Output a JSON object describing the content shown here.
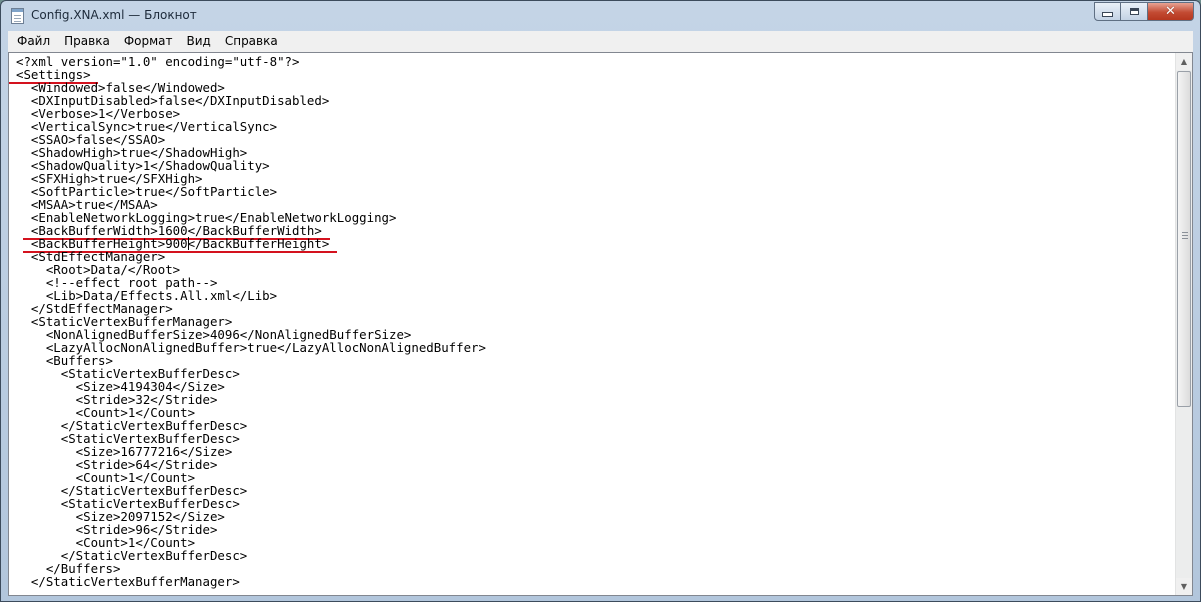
{
  "window": {
    "title": "Config.XNA.xml — Блокнот",
    "icon": "notepad-icon",
    "controls": [
      "minimize-icon",
      "maximize-icon",
      "close-icon"
    ]
  },
  "menu": [
    "Файл",
    "Правка",
    "Формат",
    "Вид",
    "Справка"
  ],
  "editor": {
    "lines": [
      "<?xml version=\"1.0\" encoding=\"utf-8\"?>",
      "<Settings>",
      "  <Windowed>false</Windowed>",
      "  <DXInputDisabled>false</DXInputDisabled>",
      "  <Verbose>1</Verbose>",
      "  <VerticalSync>true</VerticalSync>",
      "  <SSAO>false</SSAO>",
      "  <ShadowHigh>true</ShadowHigh>",
      "  <ShadowQuality>1</ShadowQuality>",
      "  <SFXHigh>true</SFXHigh>",
      "  <SoftParticle>true</SoftParticle>",
      "  <MSAA>true</MSAA>",
      "  <EnableNetworkLogging>true</EnableNetworkLogging>",
      "  <BackBufferWidth>1600</BackBufferWidth>",
      "  <BackBufferHeight>900</BackBufferHeight>",
      "  <StdEffectManager>",
      "    <Root>Data/</Root>",
      "    <!--effect root path-->",
      "    <Lib>Data/Effects.All.xml</Lib>",
      "  </StdEffectManager>",
      "  <StaticVertexBufferManager>",
      "    <NonAlignedBufferSize>4096</NonAlignedBufferSize>",
      "    <LazyAllocNonAlignedBuffer>true</LazyAllocNonAlignedBuffer>",
      "    <Buffers>",
      "      <StaticVertexBufferDesc>",
      "        <Size>4194304</Size>",
      "        <Stride>32</Stride>",
      "        <Count>1</Count>",
      "      </StaticVertexBufferDesc>",
      "      <StaticVertexBufferDesc>",
      "        <Size>16777216</Size>",
      "        <Stride>64</Stride>",
      "        <Count>1</Count>",
      "      </StaticVertexBufferDesc>",
      "      <StaticVertexBufferDesc>",
      "        <Size>2097152</Size>",
      "        <Stride>96</Stride>",
      "        <Count>1</Count>",
      "      </StaticVertexBufferDesc>",
      "    </Buffers>",
      "  </StaticVertexBufferManager>"
    ],
    "highlighted_lines": [
      1,
      13,
      14
    ],
    "highlight_color": "#d4121e"
  },
  "scrollbar": {
    "up_icon": "scroll-up-arrow-icon",
    "down_icon": "scroll-down-arrow-icon"
  }
}
